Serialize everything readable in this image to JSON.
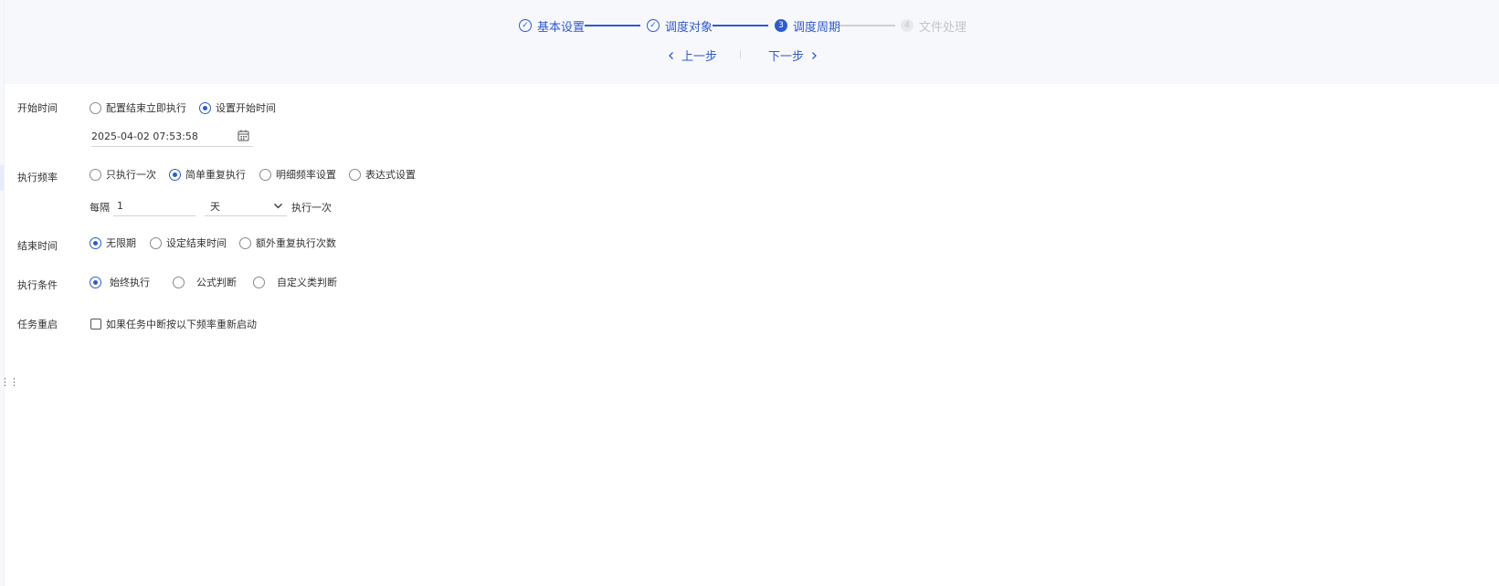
{
  "steps": [
    {
      "label": "基本设置",
      "state": "done",
      "marker": "✓"
    },
    {
      "label": "调度对象",
      "state": "done",
      "marker": "✓"
    },
    {
      "label": "调度周期",
      "state": "current",
      "marker": "3"
    },
    {
      "label": "文件处理",
      "state": "todo",
      "marker": "4"
    }
  ],
  "nav": {
    "prev_label": "上一步",
    "next_label": "下一步"
  },
  "start_time": {
    "label": "开始时间",
    "options": [
      "配置结束立即执行",
      "设置开始时间"
    ],
    "selected": 1,
    "datetime_value": "2025-04-02 07:53:58"
  },
  "frequency": {
    "label": "执行频率",
    "options": [
      "只执行一次",
      "简单重复执行",
      "明细频率设置",
      "表达式设置"
    ],
    "selected": 1,
    "every_label": "每隔",
    "interval_value": "1",
    "unit_value": "天",
    "suffix_label": "执行一次"
  },
  "end_time": {
    "label": "结束时间",
    "options": [
      "无限期",
      "设定结束时间",
      "额外重复执行次数"
    ],
    "selected": 0
  },
  "condition": {
    "label": "执行条件",
    "options": [
      "始终执行",
      "公式判断",
      "自定义类判断"
    ],
    "selected": 0
  },
  "restart": {
    "label": "任务重启",
    "checkbox_label": "如果任务中断按以下频率重新启动",
    "checked": false
  },
  "colors": {
    "accent": "#2f5bd0",
    "header_bg": "#f7f8fc",
    "inactive": "#c4c4c8"
  }
}
